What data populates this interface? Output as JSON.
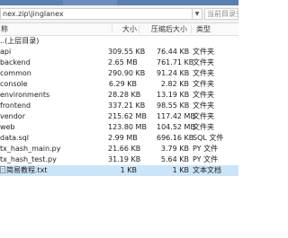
{
  "address": {
    "path": "nex.zip\\jinglanex",
    "search_placeholder": "当前目录查找(支持包内查找)"
  },
  "columns": {
    "name": "称",
    "size": "大小",
    "packed": "压缩后大小",
    "type": "类型"
  },
  "files": [
    {
      "name": "..(上层目录)",
      "size": "",
      "packed": "",
      "type": ""
    },
    {
      "name": "api",
      "size": "309.55 KB",
      "packed": "76.44 KB",
      "type": "文件夹"
    },
    {
      "name": "backend",
      "size": "2.65 MB",
      "packed": "761.71 KB",
      "type": "文件夹"
    },
    {
      "name": "common",
      "size": "290.90 KB",
      "packed": "91.24 KB",
      "type": "文件夹"
    },
    {
      "name": "console",
      "size": "6.29 KB",
      "packed": "2.82 KB",
      "type": "文件夹"
    },
    {
      "name": "environments",
      "size": "28.28 KB",
      "packed": "13.19 KB",
      "type": "文件夹"
    },
    {
      "name": "frontend",
      "size": "337.21 KB",
      "packed": "98.55 KB",
      "type": "文件夹"
    },
    {
      "name": "vendor",
      "size": "215.62 MB",
      "packed": "117.42 MB",
      "type": "文件夹"
    },
    {
      "name": "web",
      "size": "123.80 MB",
      "packed": "104.52 MB",
      "type": "文件夹"
    },
    {
      "name": "data.sql",
      "size": "2.99 MB",
      "packed": "696.16 KB",
      "type": "SQL 文件"
    },
    {
      "name": "tx_hash_main.py",
      "size": "21.66 KB",
      "packed": "3.79 KB",
      "type": "PY 文件"
    },
    {
      "name": "tx_hash_test.py",
      "size": "31.19 KB",
      "packed": "5.64 KB",
      "type": "PY 文件"
    },
    {
      "name": "简易教程.txt",
      "size": "1 KB",
      "packed": "1 KB",
      "type": "文本文档",
      "selected": true
    }
  ]
}
